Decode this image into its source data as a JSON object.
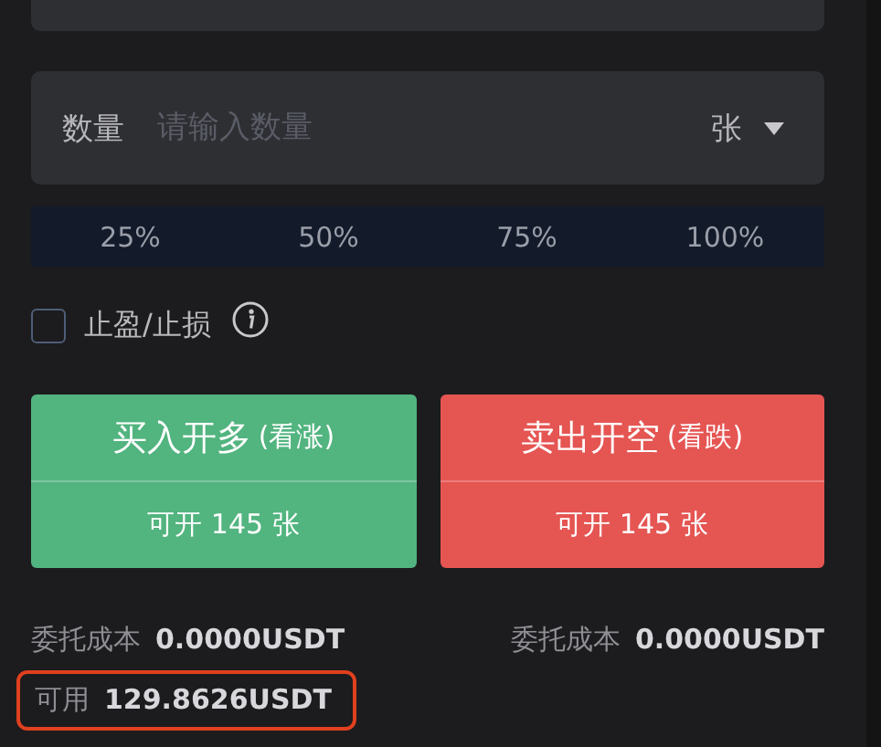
{
  "quantity_field": {
    "label": "数量",
    "placeholder": "请输入数量",
    "unit": "张"
  },
  "percent_options": [
    {
      "label": "25%",
      "selected": false
    },
    {
      "label": "50%",
      "selected": false
    },
    {
      "label": "75%",
      "selected": false
    },
    {
      "label": "100%",
      "selected": false
    }
  ],
  "take_profit_stop_loss": {
    "label": "止盈/止损",
    "checked": false
  },
  "order_buttons": [
    {
      "kind": "buy",
      "label": "买入开多",
      "hint": "(看涨)",
      "available": "可开 145 张"
    },
    {
      "kind": "sell",
      "label": "卖出开空",
      "hint": "(看跌)",
      "available": "可开 145 张"
    }
  ],
  "costs": [
    {
      "label": "委托成本",
      "value": "0.0000USDT"
    },
    {
      "label": "委托成本",
      "value": "0.0000USDT"
    }
  ],
  "available_balance": {
    "label": "可用",
    "value": "129.8626USDT",
    "highlighted": true
  }
}
